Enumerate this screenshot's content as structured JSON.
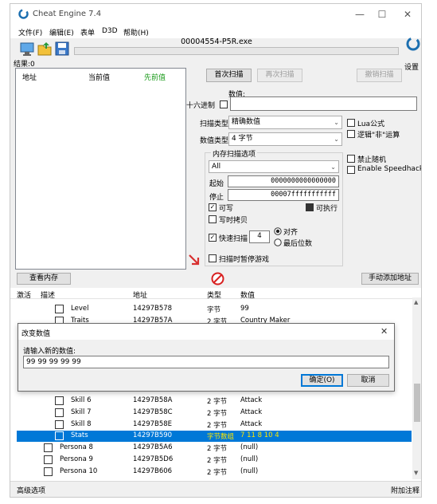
{
  "window": {
    "title": "Cheat Engine 7.4",
    "min_glyph": "—",
    "max_glyph": "☐",
    "close_glyph": "✕",
    "logo_icon": "cheat-engine-logo-icon"
  },
  "menu": [
    "文件(F)",
    "编辑(E)",
    "表单",
    "D3D",
    "帮助(H)"
  ],
  "process": "00004554-P5R.exe",
  "toolbar_icons": [
    "open-process-icon",
    "open-file-icon",
    "save-icon"
  ],
  "settings_label": "设置",
  "results_label": "结果:0",
  "found_list": {
    "headers": [
      "地址",
      "当前值",
      "先前值"
    ]
  },
  "scan": {
    "first_scan": "首次扫描",
    "next_scan": "再次扫描",
    "undo_scan": "撤销扫描",
    "value_label": "数值:",
    "hex_label": "十六进制",
    "scan_type_label": "扫描类型",
    "scan_type_value": "精确数值",
    "value_type_label": "数值类型",
    "value_type_value": "4 字节",
    "lua_formula": "Lua公式",
    "not_logic": "逻辑\"非\"运算",
    "disable_random": "禁止随机",
    "enable_speedhack": "Enable Speedhack"
  },
  "memory_options": {
    "title": "内存扫描选项",
    "region": "All",
    "start_label": "起始",
    "start_value": "0000000000000000",
    "stop_label": "停止",
    "stop_value": "00007fffffffffff",
    "writable": "可写",
    "executable": "可执行",
    "copy_on_write": "写时拷贝",
    "fast_scan": "快速扫描",
    "fast_scan_value": "4",
    "alignment": "对齐",
    "last_digits": "最后位数",
    "pause_game": "扫描时暂停游戏"
  },
  "view_memory": "查看内存",
  "add_address_manually": "手动添加地址",
  "table": {
    "headers": [
      "激活",
      "描述",
      "地址",
      "类型",
      "数值"
    ],
    "rows_top": [
      {
        "desc": "Level",
        "addr": "14297B578",
        "type": "字节",
        "value": "99"
      },
      {
        "desc": "Traits",
        "addr": "14297B57A",
        "type": "2 字节",
        "value": "Country Maker"
      }
    ],
    "rows_bottom": [
      {
        "desc": "Skill 6",
        "addr": "14297B58A",
        "type": "2 字节",
        "value": "Attack"
      },
      {
        "desc": "Skill 7",
        "addr": "14297B58C",
        "type": "2 字节",
        "value": "Attack"
      },
      {
        "desc": "Skill 8",
        "addr": "14297B58E",
        "type": "2 字节",
        "value": "Attack"
      },
      {
        "desc": "Stats",
        "addr": "14297B590",
        "type": "字节数组",
        "value": "7 11 8 10 4"
      },
      {
        "desc": "Persona 8",
        "addr": "14297B5A6",
        "type": "2 字节",
        "value": "(null)"
      },
      {
        "desc": "Persona 9",
        "addr": "14297B5D6",
        "type": "2 字节",
        "value": "(null)"
      },
      {
        "desc": "Persona 10",
        "addr": "14297B606",
        "type": "2 字节",
        "value": "(null)"
      }
    ]
  },
  "dialog": {
    "title": "改变数值",
    "prompt": "请输入新的数值:",
    "input_value": "99 99 99 99 99",
    "ok": "确定(O)",
    "cancel": "取消",
    "close_glyph": "✕"
  },
  "status": {
    "left": "高级选项",
    "right": "附加注释"
  }
}
